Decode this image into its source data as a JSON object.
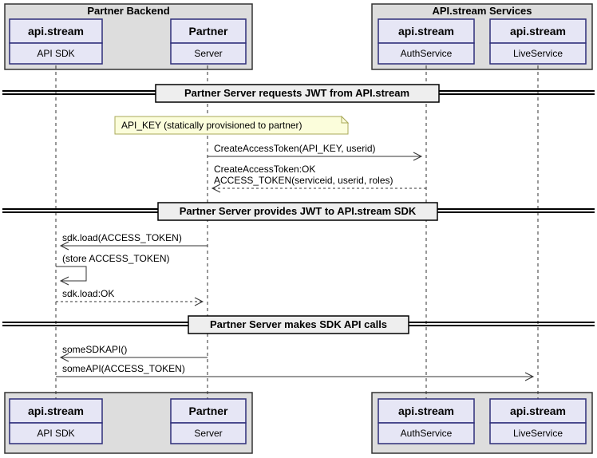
{
  "groups": {
    "backend": "Partner Backend",
    "services": "API.stream Services"
  },
  "participants": {
    "sdk": {
      "title": "api.stream",
      "sub": "API SDK"
    },
    "server": {
      "title": "Partner",
      "sub": "Server"
    },
    "auth": {
      "title": "api.stream",
      "sub": "AuthService"
    },
    "live": {
      "title": "api.stream",
      "sub": "LiveService"
    }
  },
  "dividers": {
    "d1": "Partner Server requests JWT from API.stream",
    "d2": "Partner Server provides JWT to API.stream SDK",
    "d3": "Partner Server makes SDK API calls"
  },
  "note": "API_KEY (statically provisioned to partner)",
  "messages": {
    "m1": "CreateAccessToken(API_KEY, userid)",
    "m2a": "CreateAccessToken:OK",
    "m2b": "ACCESS_TOKEN(serviceid, userid, roles)",
    "m3": "sdk.load(ACCESS_TOKEN)",
    "m4": "(store ACCESS_TOKEN)",
    "m5": "sdk.load:OK",
    "m6": "someSDKAPI()",
    "m7": "someAPI(ACCESS_TOKEN)"
  }
}
